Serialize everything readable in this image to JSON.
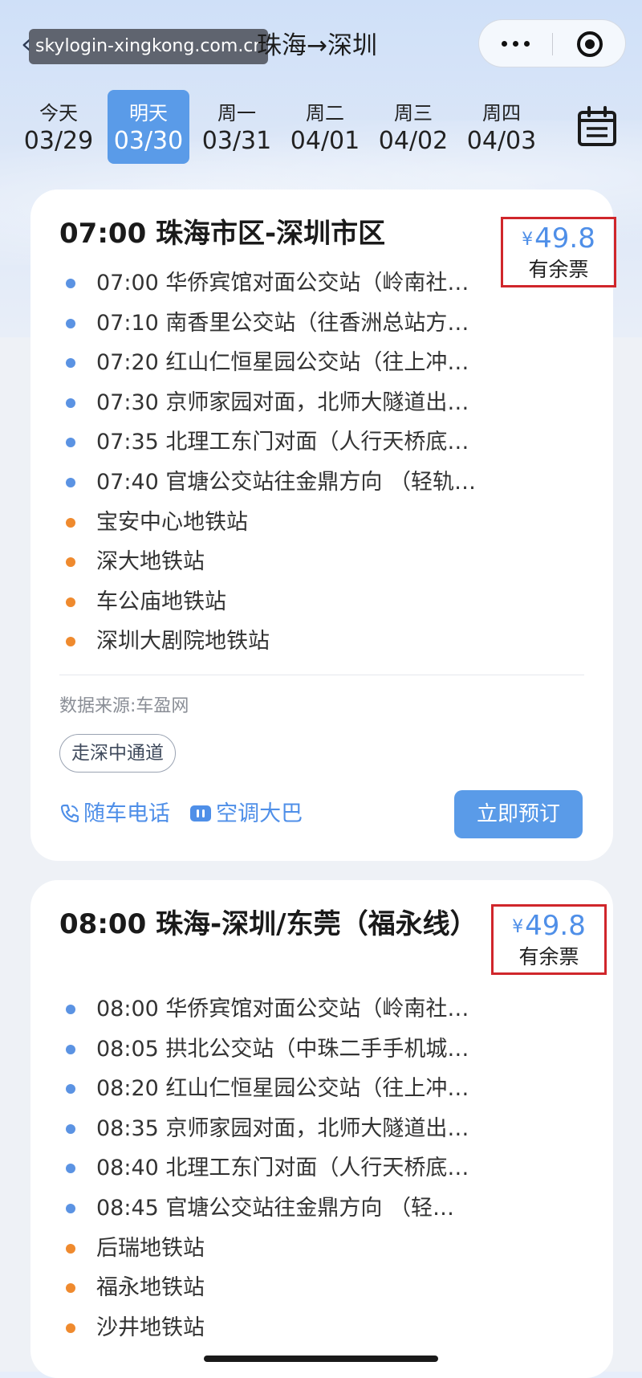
{
  "nav": {
    "title": "珠海→深圳",
    "watermark": "skylogin-xingkong.com.cn"
  },
  "dates": [
    {
      "weekday": "今天",
      "date": "03/29",
      "active": false
    },
    {
      "weekday": "明天",
      "date": "03/30",
      "active": true
    },
    {
      "weekday": "周一",
      "date": "03/31",
      "active": false
    },
    {
      "weekday": "周二",
      "date": "04/01",
      "active": false
    },
    {
      "weekday": "周三",
      "date": "04/02",
      "active": false
    },
    {
      "weekday": "周四",
      "date": "04/03",
      "active": false
    }
  ],
  "trips": [
    {
      "title": "07:00 珠海市区-深圳市区",
      "currency": "¥",
      "price": "49.8",
      "availability": "有余票",
      "stops": [
        {
          "text": "07:00 华侨宾馆对面公交站（岭南社…",
          "color": "blue"
        },
        {
          "text": "07:10 南香里公交站（往香洲总站方…",
          "color": "blue"
        },
        {
          "text": "07:20 红山仁恒星园公交站（往上冲…",
          "color": "blue"
        },
        {
          "text": "07:30 京师家园对面，北师大隧道出…",
          "color": "blue"
        },
        {
          "text": "07:35 北理工东门对面（人行天桥底…",
          "color": "blue"
        },
        {
          "text": "07:40 官塘公交站往金鼎方向 （轻轨…",
          "color": "blue"
        },
        {
          "text": "宝安中心地铁站",
          "color": "orange"
        },
        {
          "text": "深大地铁站",
          "color": "orange"
        },
        {
          "text": "车公庙地铁站",
          "color": "orange"
        },
        {
          "text": "深圳大剧院地铁站",
          "color": "orange"
        }
      ],
      "source": "数据来源:车盈网",
      "route_tag": "走深中通道",
      "feature_phone": "随车电话",
      "feature_ac": "空调大巴",
      "book_label": "立即预订"
    },
    {
      "title": "08:00 珠海-深圳/东莞（福永线）",
      "currency": "¥",
      "price": "49.8",
      "availability": "有余票",
      "stops": [
        {
          "text": "08:00 华侨宾馆对面公交站（岭南社…",
          "color": "blue"
        },
        {
          "text": "08:05 拱北公交站（中珠二手手机城…",
          "color": "blue"
        },
        {
          "text": "08:20 红山仁恒星园公交站（往上冲…",
          "color": "blue"
        },
        {
          "text": "08:35 京师家园对面，北师大隧道出…",
          "color": "blue"
        },
        {
          "text": "08:40 北理工东门对面（人行天桥底…",
          "color": "blue"
        },
        {
          "text": "08:45 官塘公交站往金鼎方向 （轻…",
          "color": "blue"
        },
        {
          "text": "后瑞地铁站",
          "color": "orange"
        },
        {
          "text": "福永地铁站",
          "color": "orange"
        },
        {
          "text": "沙井地铁站",
          "color": "orange"
        }
      ]
    }
  ],
  "colors": {
    "accent": "#5a9be8",
    "price": "#4f8fe8",
    "highlight_box": "#d0262b",
    "dot_blue": "#5b93e3",
    "dot_orange": "#ef8a2e"
  },
  "icons": {
    "back": "chevron-left-icon",
    "more": "more-dots-icon",
    "close": "close-circle-icon",
    "calendar": "calendar-icon",
    "phone": "phone-icon",
    "ac": "ac-icon"
  }
}
